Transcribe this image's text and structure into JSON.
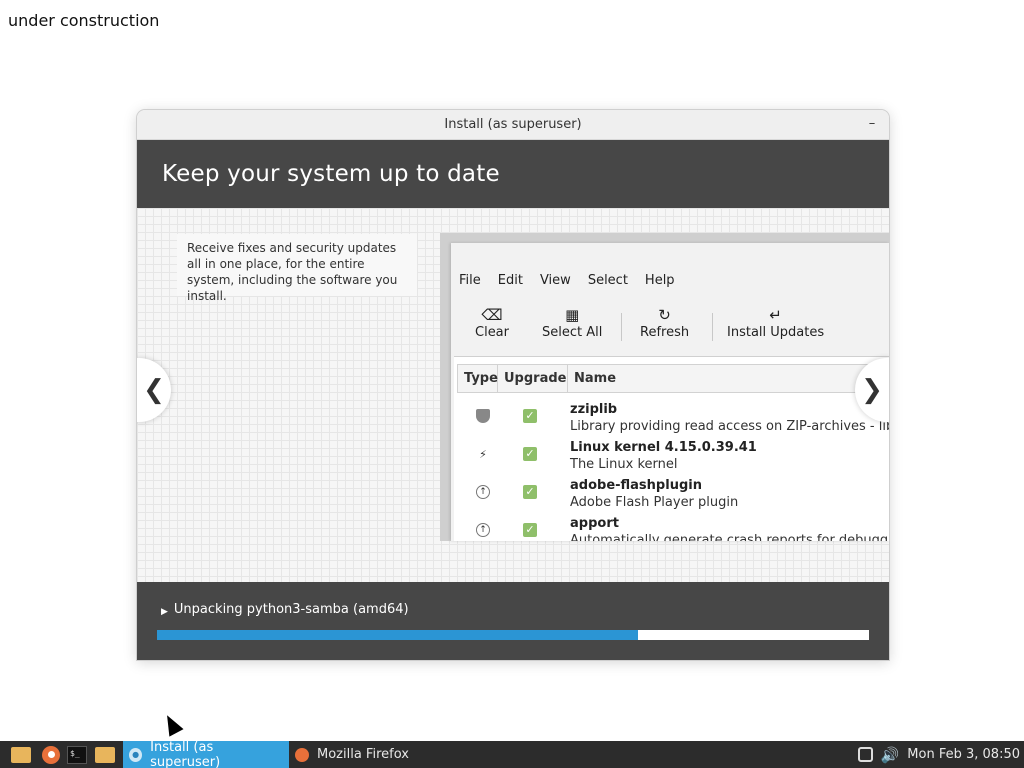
{
  "background": {
    "text": "under construction"
  },
  "window": {
    "title": "Install (as superuser)",
    "minimize_label": "–",
    "banner_title": "Keep your system up to date",
    "description": "Receive fixes and security updates all in one place, for the entire system, including the software you install.",
    "nav_prev": "❮",
    "nav_next": "❯",
    "mock": {
      "menu": [
        "File",
        "Edit",
        "View",
        "Select",
        "Help"
      ],
      "toolbar": [
        {
          "label": "Clear",
          "icon": "⌫"
        },
        {
          "label": "Select All",
          "icon": "▦"
        },
        {
          "label": "Refresh",
          "icon": "↻"
        },
        {
          "label": "Install Updates",
          "icon": "↵"
        }
      ],
      "columns": {
        "type": "Type",
        "upgrade": "Upgrade",
        "name": "Name"
      },
      "rows": [
        {
          "type_icon": "shield-icon",
          "glyph": "",
          "name": "zziplib",
          "desc": "Library providing read access on ZIP-archives - library"
        },
        {
          "type_icon": "lightning-icon",
          "glyph": "⚡",
          "name": "Linux kernel 4.15.0.39.41",
          "desc": "The Linux kernel"
        },
        {
          "type_icon": "arrow-up-icon",
          "glyph": "↑",
          "name": "adobe-flashplugin",
          "desc": "Adobe Flash Player plugin"
        },
        {
          "type_icon": "arrow-up-icon",
          "glyph": "↑",
          "name": "apport",
          "desc": "Automatically generate crash reports for debugging"
        }
      ],
      "check_glyph": "✓"
    },
    "progress": {
      "status": "Unpacking python3-samba (amd64)",
      "fraction": 0.675,
      "expander": "▶"
    }
  },
  "taskbar": {
    "tasks": [
      {
        "label": "Install (as superuser)",
        "active": true
      },
      {
        "label": "Mozilla Firefox",
        "active": false
      }
    ],
    "clock": "Mon Feb  3, 08:50",
    "terminal_glyph": "$_",
    "volume_glyph": "🔊"
  },
  "colors": {
    "banner": "#474747",
    "progress_fill": "#2b95d4",
    "active_task": "#36a2dd",
    "checkbox": "#8fbf6a"
  }
}
